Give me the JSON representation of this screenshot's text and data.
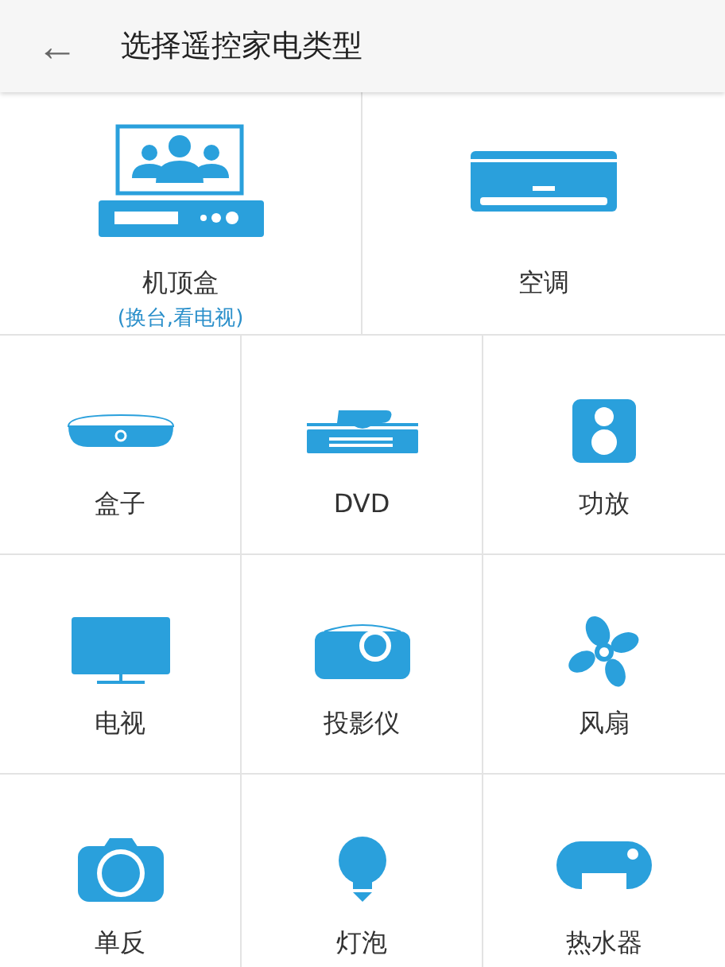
{
  "header": {
    "back_icon": "←",
    "title": "选择遥控家电类型"
  },
  "featured": [
    {
      "kind": "set-top-box",
      "label": "机顶盒",
      "subtitle": "(换台,看电视)"
    },
    {
      "kind": "air-conditioner",
      "label": "空调"
    }
  ],
  "devices": [
    {
      "kind": "box",
      "label": "盒子"
    },
    {
      "kind": "dvd",
      "label": "DVD"
    },
    {
      "kind": "amplifier",
      "label": "功放"
    },
    {
      "kind": "tv",
      "label": "电视"
    },
    {
      "kind": "projector",
      "label": "投影仪"
    },
    {
      "kind": "fan",
      "label": "风扇"
    },
    {
      "kind": "camera",
      "label": "单反"
    },
    {
      "kind": "bulb",
      "label": "灯泡"
    },
    {
      "kind": "water-heater",
      "label": "热水器"
    }
  ]
}
